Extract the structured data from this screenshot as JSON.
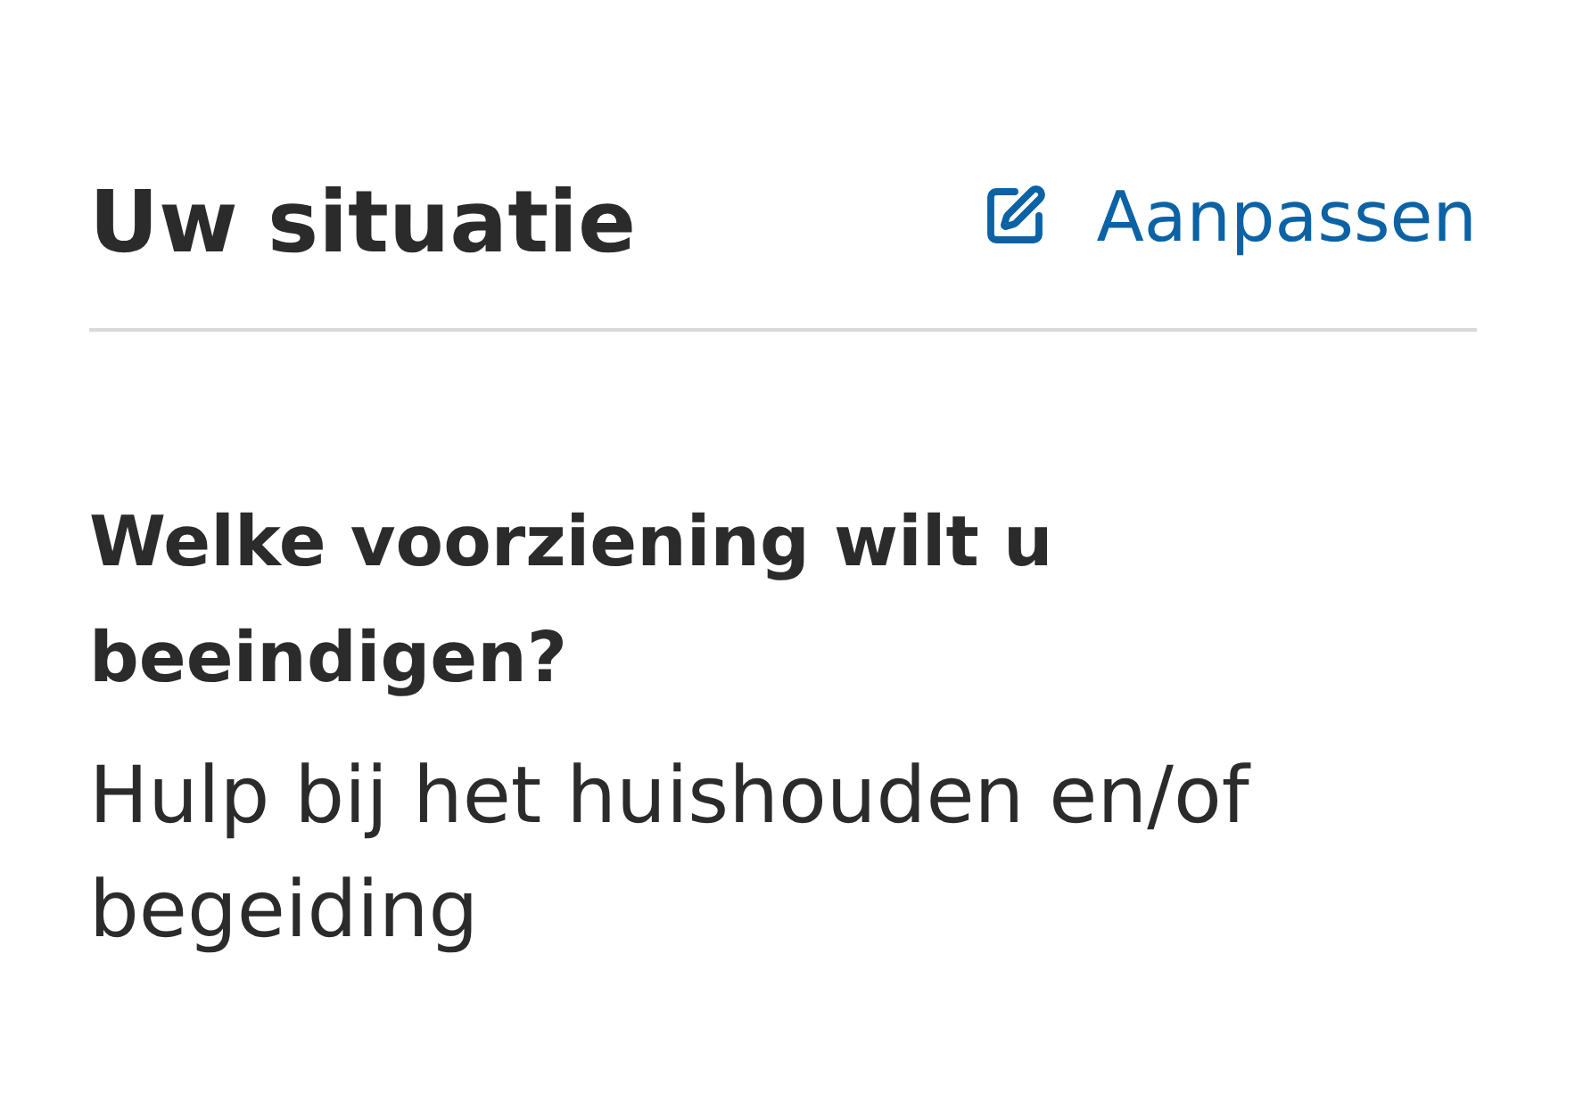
{
  "section": {
    "title": "Uw situatie",
    "action": {
      "label": "Aanpassen"
    }
  },
  "fields": [
    {
      "question": "Welke voorziening wilt u beeindigen?",
      "answer": "Hulp bij het huishouden en/of begeiding"
    }
  ]
}
